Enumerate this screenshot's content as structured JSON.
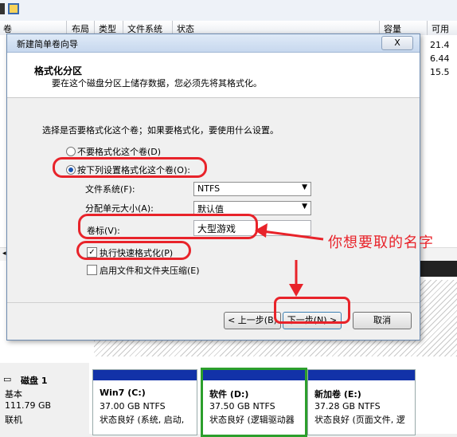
{
  "columns": {
    "vol": "卷",
    "layout": "布局",
    "type": "类型",
    "fs": "文件系统",
    "status": "状态",
    "capacity": "容量",
    "avail": "可用"
  },
  "avail_values": [
    "21.4",
    "6.44",
    "15.5"
  ],
  "disk1": {
    "name": "磁盘 1",
    "kind": "基本",
    "size": "111.79 GB",
    "state": "联机"
  },
  "partitions": [
    {
      "name": "Win7  (C:)",
      "size": "37.00 GB NTFS",
      "status": "状态良好 (系统, 启动,"
    },
    {
      "name": "软件  (D:)",
      "size": "37.50 GB NTFS",
      "status": "状态良好 (逻辑驱动器"
    },
    {
      "name": "新加卷  (E:)",
      "size": "37.28 GB NTFS",
      "status": "状态良好 (页面文件, 逻"
    }
  ],
  "wizard": {
    "title": "新建简单卷向导",
    "close_label": "X",
    "heading": "格式化分区",
    "subheading": "要在这个磁盘分区上储存数据，您必须先将其格式化。",
    "question": "选择是否要格式化这个卷；如果要格式化，要使用什么设置。",
    "opt_no_format": "不要格式化这个卷(D)",
    "opt_format": "按下列设置格式化这个卷(O):",
    "fs_label": "文件系统(F):",
    "fs_value": "NTFS",
    "alloc_label": "分配单元大小(A):",
    "alloc_value": "默认值",
    "vol_label": "卷标(V):",
    "vol_value": "大型游戏",
    "quick_format": "执行快速格式化(P)",
    "compress": "启用文件和文件夹压缩(E)",
    "back": "< 上一步(B)",
    "next": "下一步(N) >",
    "cancel": "取消"
  },
  "annotation": "你想要取的名字",
  "colors": {
    "accent": "#e8232a",
    "partition_bar": "#1232a8",
    "selected_part": "#2c9f2c"
  }
}
